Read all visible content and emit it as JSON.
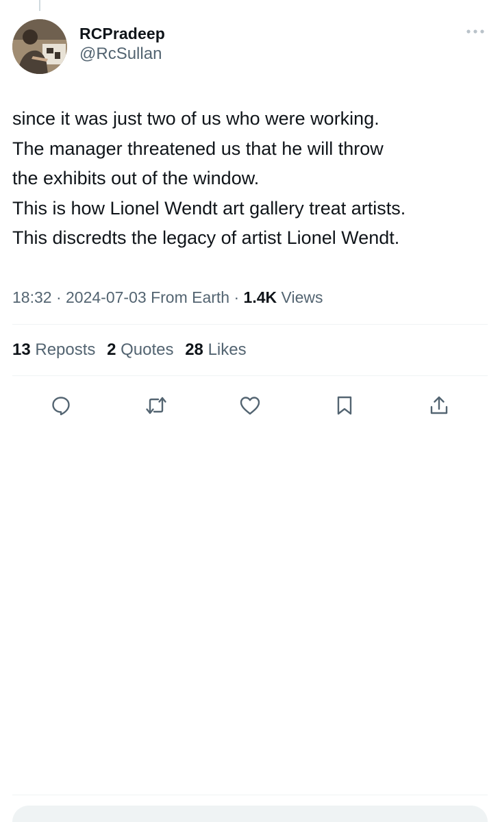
{
  "author": {
    "display_name": "RCPradeep",
    "handle": "@RcSullan"
  },
  "tweet": {
    "lines": [
      "since it was just two of us who were working.",
      "The manager threatened us that he will throw",
      "the exhibits out of the window.",
      "This is how Lionel Wendt art gallery treat artists.",
      "This discredts the legacy of artist Lionel Wendt."
    ],
    "time": "18:32",
    "date": "2024-07-03",
    "source": "From Earth",
    "views_count": "1.4K",
    "views_label": "Views",
    "separator": "·"
  },
  "stats": {
    "reposts": {
      "count": "13",
      "label": "Reposts"
    },
    "quotes": {
      "count": "2",
      "label": "Quotes"
    },
    "likes": {
      "count": "28",
      "label": "Likes"
    }
  },
  "actions": [
    "reply-icon",
    "repost-icon",
    "like-icon",
    "bookmark-icon",
    "share-icon"
  ],
  "colors": {
    "text_primary": "#0f1419",
    "text_secondary": "#536471",
    "divider": "#eff3f4"
  }
}
